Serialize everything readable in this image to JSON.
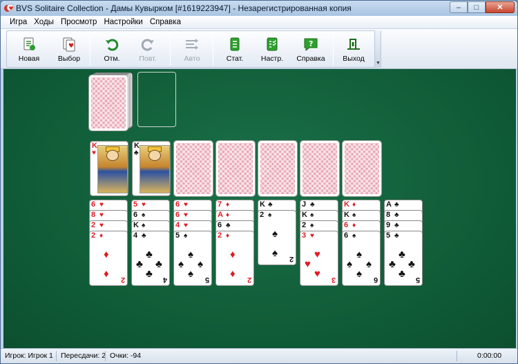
{
  "titlebar": {
    "title": "BVS Solitaire Collection  -  Дамы Кувырком [#1619223947] - Незарегистрированная копия",
    "minimize": "–",
    "maximize": "□",
    "close": "✕"
  },
  "menu": [
    "Игра",
    "Ходы",
    "Просмотр",
    "Настройки",
    "Справка"
  ],
  "toolbar": {
    "new": "Новая",
    "choose": "Выбор",
    "undo": "Отм.",
    "redo": "Повт.",
    "auto": "Авто",
    "stats": "Стат.",
    "settings": "Настр.",
    "help": "Справка",
    "exit": "Выход"
  },
  "game": {
    "foundations": [
      {
        "rank": "K",
        "suit": "♥",
        "color": "red"
      },
      {
        "rank": "K",
        "suit": "♣",
        "color": "black"
      }
    ],
    "tableau": [
      {
        "cards": [
          {
            "rank": "6",
            "suit": "♥",
            "c": "red"
          },
          {
            "rank": "8",
            "suit": "♥",
            "c": "red"
          },
          {
            "rank": "2",
            "suit": "♥",
            "c": "red"
          },
          {
            "rank": "2",
            "suit": "♦",
            "c": "red"
          }
        ]
      },
      {
        "cards": [
          {
            "rank": "5",
            "suit": "♥",
            "c": "red"
          },
          {
            "rank": "6",
            "suit": "♠",
            "c": "black"
          },
          {
            "rank": "K",
            "suit": "♠",
            "c": "black"
          },
          {
            "rank": "4",
            "suit": "♣",
            "c": "black"
          }
        ]
      },
      {
        "cards": [
          {
            "rank": "6",
            "suit": "♥",
            "c": "red"
          },
          {
            "rank": "6",
            "suit": "♥",
            "c": "red"
          },
          {
            "rank": "4",
            "suit": "♥",
            "c": "red"
          },
          {
            "rank": "5",
            "suit": "♠",
            "c": "black"
          }
        ]
      },
      {
        "cards": [
          {
            "rank": "7",
            "suit": "♦",
            "c": "red"
          },
          {
            "rank": "A",
            "suit": "♦",
            "c": "red"
          },
          {
            "rank": "6",
            "suit": "♣",
            "c": "black"
          },
          {
            "rank": "2",
            "suit": "♦",
            "c": "red"
          }
        ]
      },
      {
        "cards": [
          {
            "rank": "K",
            "suit": "♣",
            "c": "black"
          },
          {
            "rank": "2",
            "suit": "♠",
            "c": "black"
          }
        ]
      },
      {
        "cards": [
          {
            "rank": "J",
            "suit": "♣",
            "c": "black"
          },
          {
            "rank": "K",
            "suit": "♠",
            "c": "black"
          },
          {
            "rank": "2",
            "suit": "♠",
            "c": "black"
          },
          {
            "rank": "3",
            "suit": "♥",
            "c": "red"
          }
        ]
      },
      {
        "cards": [
          {
            "rank": "K",
            "suit": "♦",
            "c": "red"
          },
          {
            "rank": "K",
            "suit": "♠",
            "c": "black"
          },
          {
            "rank": "6",
            "suit": "♦",
            "c": "red"
          },
          {
            "rank": "6",
            "suit": "♠",
            "c": "black"
          }
        ]
      },
      {
        "cards": [
          {
            "rank": "A",
            "suit": "♣",
            "c": "black"
          },
          {
            "rank": "8",
            "suit": "♣",
            "c": "black"
          },
          {
            "rank": "9",
            "suit": "♣",
            "c": "black"
          },
          {
            "rank": "5",
            "suit": "♣",
            "c": "black"
          }
        ]
      }
    ]
  },
  "status": {
    "player": "Игрок: Игрок 1",
    "redeals": "Пересдачи: 2",
    "score": "Очки:   -94",
    "time": "0:00:00"
  }
}
